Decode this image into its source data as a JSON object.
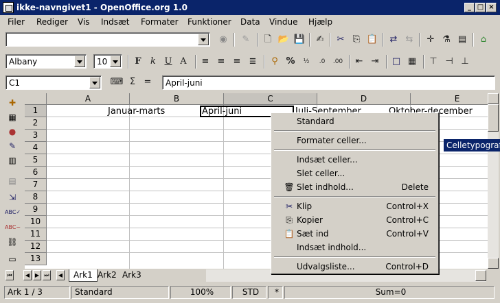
{
  "window": {
    "title": "ikke-navngivet1 - OpenOffice.org 1.0"
  },
  "menubar": [
    "Filer",
    "Rediger",
    "Vis",
    "Indsæt",
    "Formater",
    "Funktioner",
    "Data",
    "Vindue",
    "Hjælp"
  ],
  "format_toolbar": {
    "font_name": "Albany",
    "font_size": "10",
    "bold": "F",
    "italic": "k",
    "underline": "U",
    "font_color": "A",
    "percent": "%"
  },
  "formula_bar": {
    "name_box": "C1",
    "sum_symbol": "Σ",
    "equals_symbol": "=",
    "content": "April-juni"
  },
  "sheet": {
    "columns": [
      "A",
      "B",
      "C",
      "D",
      "E"
    ],
    "selected_column": "C",
    "rows": [
      "1",
      "2",
      "3",
      "4",
      "5",
      "6",
      "7",
      "8",
      "9",
      "10",
      "11",
      "12",
      "13"
    ],
    "selected_row": "1",
    "cells": {
      "B1": "Januar-marts",
      "C1": "April-juni",
      "D1": "Juli-September",
      "E1": "Oktober-december"
    },
    "tabs": [
      "Ark1",
      "Ark2",
      "Ark3"
    ],
    "active_tab": "Ark1"
  },
  "context_menu": {
    "items": [
      {
        "label": "Standard",
        "shortcut": ""
      },
      {
        "label": "Formater celler...",
        "shortcut": ""
      },
      {
        "label": "Indsæt celler...",
        "shortcut": ""
      },
      {
        "label": "Slet celler...",
        "shortcut": ""
      },
      {
        "label": "Slet indhold...",
        "shortcut": "Delete",
        "icon": "trash-icon"
      },
      {
        "label": "Klip",
        "shortcut": "Control+X",
        "icon": "scissors-icon"
      },
      {
        "label": "Kopier",
        "shortcut": "Control+C",
        "icon": "copy-icon"
      },
      {
        "label": "Sæt ind",
        "shortcut": "Control+V",
        "icon": "paste-icon"
      },
      {
        "label": "Indsæt indhold...",
        "shortcut": ""
      },
      {
        "label": "Udvalgsliste...",
        "shortcut": "Control+D"
      }
    ]
  },
  "tooltip": "Celletypograf",
  "statusbar": {
    "sheet_pos": "Ark 1 / 3",
    "page_style": "Standard",
    "zoom": "100%",
    "mode": "STD",
    "modified": "*",
    "sum": "Sum=0"
  },
  "colors": {
    "titlebar": "#0a246a",
    "chrome": "#d4d0c8"
  }
}
